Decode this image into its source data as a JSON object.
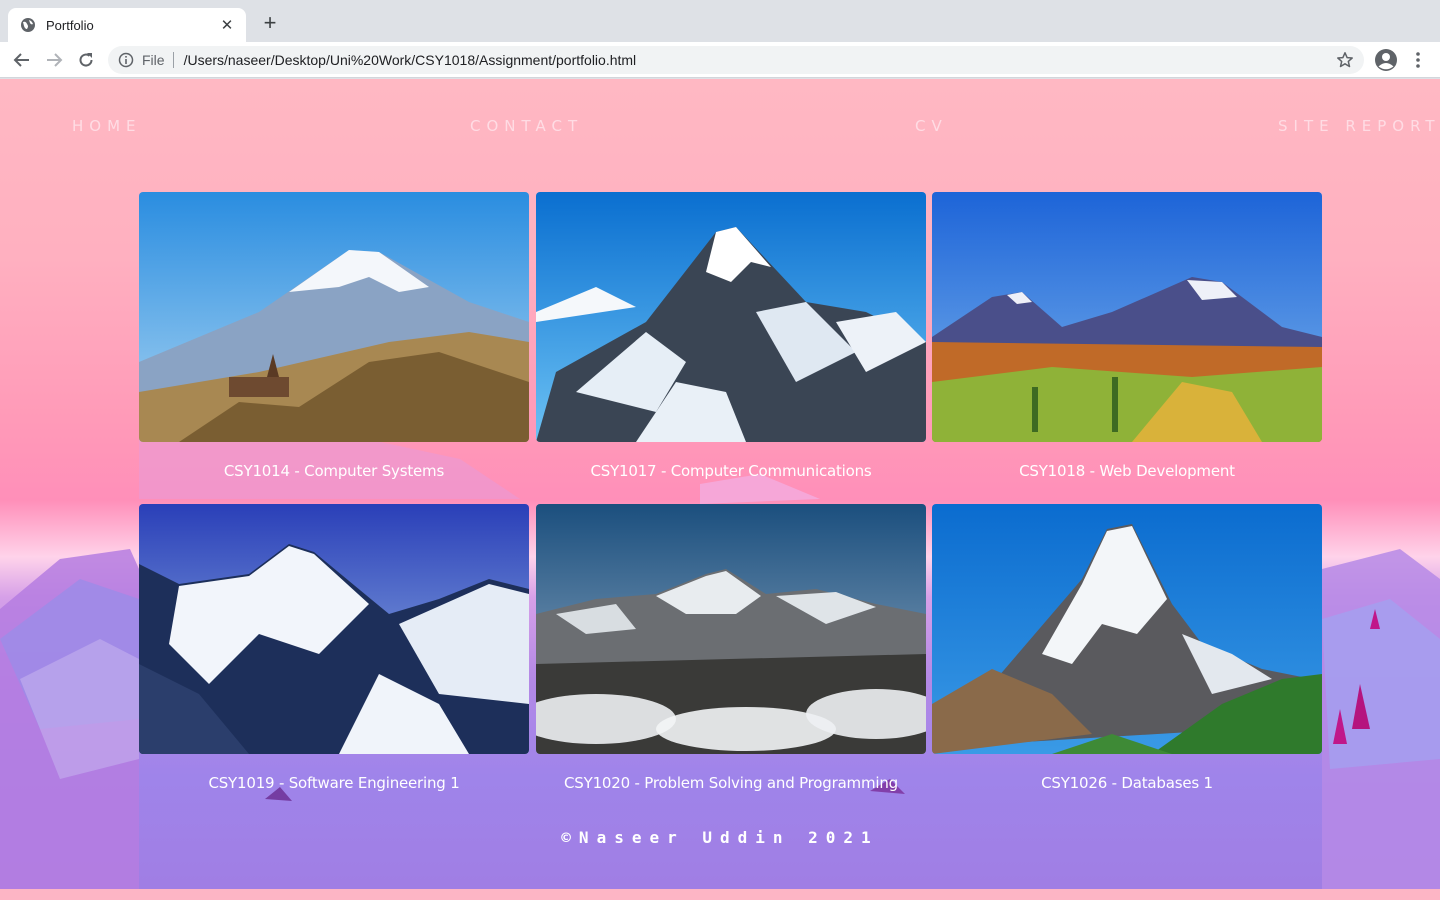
{
  "browser": {
    "tab_title": "Portfolio",
    "new_tab_symbol": "+",
    "close_symbol": "✕",
    "url_scheme": "File",
    "url": "/Users/naseer/Desktop/Uni%20Work/CSY1018/Assignment/portfolio.html"
  },
  "nav": {
    "items": [
      "HOME",
      "CONTACT",
      "CV",
      "SITE REPORT"
    ]
  },
  "gallery": {
    "cards": [
      {
        "caption": "CSY1014 - Computer Systems",
        "image": "snowy-volcano-with-monastery"
      },
      {
        "caption": "CSY1017 - Computer Communications",
        "image": "snowy-pyramid-peak"
      },
      {
        "caption": "CSY1018 - Web Development",
        "image": "twin-peaks-autumn-valley"
      },
      {
        "caption": "CSY1019 - Software Engineering 1",
        "image": "snowy-mountain-ridge"
      },
      {
        "caption": "CSY1020 - Problem Solving and Programming",
        "image": "himalaya-range-clouds"
      },
      {
        "caption": "CSY1026 - Databases 1",
        "image": "matterhorn-green-forest"
      }
    ]
  },
  "footer": {
    "text": "©Naseer Uddin 2021"
  },
  "colors": {
    "page_top": "#ffb8c3",
    "page_bottom": "#a07ee4",
    "nav_text": "#ffdce4",
    "caption_text": "#ffffff"
  }
}
